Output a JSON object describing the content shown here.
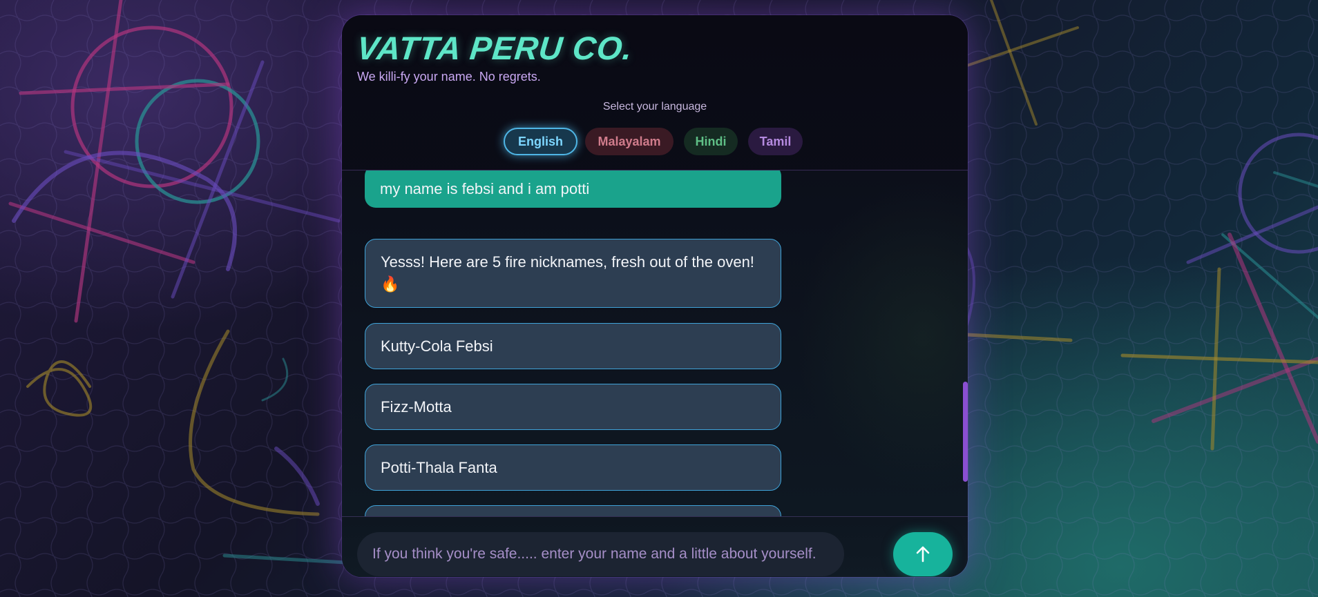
{
  "brand": {
    "title": "VATTA PERU CO.",
    "tagline": "We killi-fy your name. No regrets."
  },
  "language": {
    "label": "Select your language",
    "options": [
      "English",
      "Malayalam",
      "Hindi",
      "Tamil"
    ],
    "selected": "English"
  },
  "chat": {
    "user_message": "my name is febsi and i am potti",
    "bot_intro": "Yesss! Here are 5 fire nicknames, fresh out of the oven! 🔥",
    "nicknames": [
      "Kutty-Cola Febsi",
      "Fizz-Motta",
      "Potti-Thala Fanta"
    ]
  },
  "composer": {
    "placeholder": "If you think you're safe..... enter your name and a little about yourself.",
    "send_icon": "arrow-up-icon"
  },
  "colors": {
    "accent_teal": "#1aa38c",
    "bubble_bg": "#2d3e52",
    "bubble_border": "#3fa3d9",
    "brand": "#5ee6c7",
    "scrollbar": "#8a4fd1"
  }
}
